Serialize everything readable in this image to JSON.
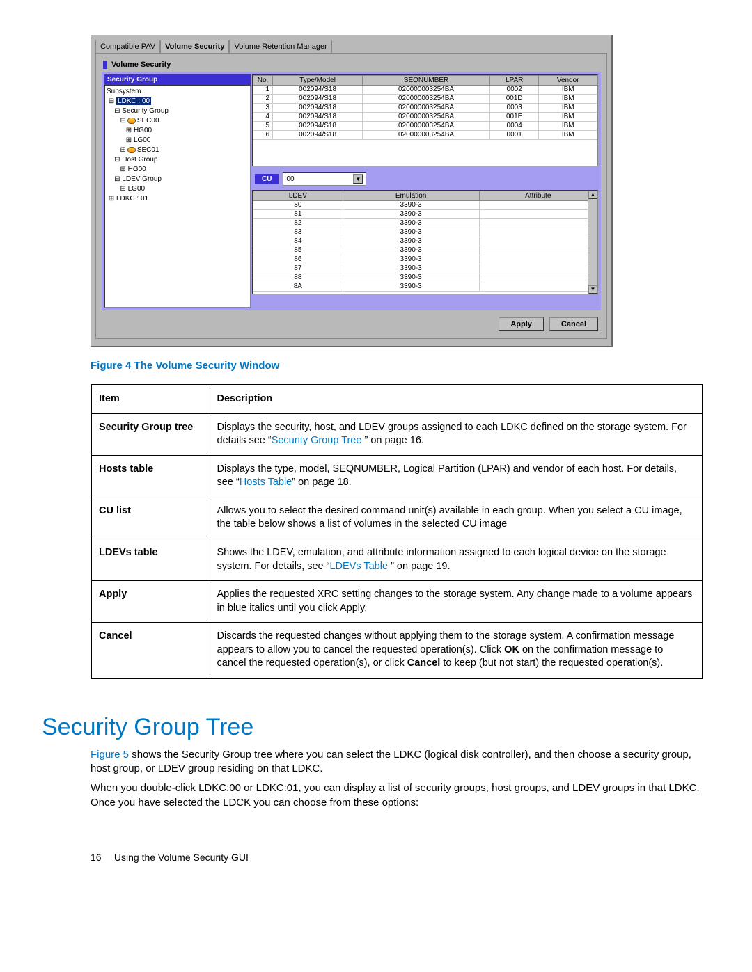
{
  "screenshot": {
    "tabs": [
      "Compatible PAV",
      "Volume Security",
      "Volume Retention Manager"
    ],
    "active_tab": "Volume Security",
    "panel_title": "Volume Security",
    "tree_header": "Security Group",
    "tree": {
      "root": "Subsystem",
      "ldkc00": "LDKC : 00",
      "secgrp": "Security Group",
      "sec00": "SEC00",
      "hg00a": "HG00",
      "lg00a": "LG00",
      "sec01": "SEC01",
      "hostgrp": "Host Group",
      "hg00b": "HG00",
      "ldevgrp": "LDEV Group",
      "lg00b": "LG00",
      "ldkc01": "LDKC : 01"
    },
    "hosts": {
      "headers": [
        "No.",
        "Type/Model",
        "SEQNUMBER",
        "LPAR",
        "Vendor"
      ],
      "rows": [
        [
          "1",
          "002094/S18",
          "020000003254BA",
          "0002",
          "IBM"
        ],
        [
          "2",
          "002094/S18",
          "020000003254BA",
          "001D",
          "IBM"
        ],
        [
          "3",
          "002094/S18",
          "020000003254BA",
          "0003",
          "IBM"
        ],
        [
          "4",
          "002094/S18",
          "020000003254BA",
          "001E",
          "IBM"
        ],
        [
          "5",
          "002094/S18",
          "020000003254BA",
          "0004",
          "IBM"
        ],
        [
          "6",
          "002094/S18",
          "020000003254BA",
          "0001",
          "IBM"
        ]
      ]
    },
    "cu": {
      "label": "CU",
      "value": "00"
    },
    "ldevs": {
      "headers": [
        "LDEV",
        "Emulation",
        "Attribute"
      ],
      "rows": [
        [
          "80",
          "3390-3",
          ""
        ],
        [
          "81",
          "3390-3",
          ""
        ],
        [
          "82",
          "3390-3",
          ""
        ],
        [
          "83",
          "3390-3",
          ""
        ],
        [
          "84",
          "3390-3",
          ""
        ],
        [
          "85",
          "3390-3",
          ""
        ],
        [
          "86",
          "3390-3",
          ""
        ],
        [
          "87",
          "3390-3",
          ""
        ],
        [
          "88",
          "3390-3",
          ""
        ],
        [
          "8A",
          "3390-3",
          ""
        ]
      ]
    },
    "buttons": {
      "apply": "Apply",
      "cancel": "Cancel"
    }
  },
  "caption": "Figure 4 The Volume Security Window",
  "table": {
    "head": [
      "Item",
      "Description"
    ],
    "rows": [
      {
        "item": "Security Group tree",
        "desc_pre": "Displays the security, host, and LDEV groups assigned to each LDKC defined on the storage system. For details see “",
        "link": "Security Group Tree ",
        "desc_post": "” on page 16."
      },
      {
        "item": "Hosts table",
        "desc_pre": "Displays the type, model, SEQNUMBER, Logical Partition (LPAR) and vendor of each host. For details, see “",
        "link": "Hosts Table",
        "desc_post": "” on page 18."
      },
      {
        "item": "CU list",
        "desc": "Allows you to select the desired command unit(s) available in each group. When you select a CU image, the table below shows a list of volumes in the selected CU image"
      },
      {
        "item": "LDEVs table",
        "desc_pre": "Shows the LDEV, emulation, and attribute information assigned to each logical device on the storage system. For details, see “",
        "link": "LDEVs Table ",
        "desc_post": "” on page 19."
      },
      {
        "item": "Apply",
        "desc": "Applies the requested XRC setting changes to the storage system. Any change made to a volume appears in blue italics until you click Apply."
      },
      {
        "item": "Cancel",
        "desc_parts": {
          "p1": "Discards the requested changes without applying them to the storage system. A confirmation message appears to allow you to cancel the requested operation(s). Click ",
          "b1": "OK",
          "p2": " on the confirmation message to cancel the requested operation(s), or click ",
          "b2": "Cancel",
          "p3": " to keep (but not start) the requested operation(s)."
        }
      }
    ]
  },
  "section_heading": "Security Group Tree",
  "para1_a": "Figure 5",
  "para1_b": " shows the Security Group tree where you can select the LDKC (logical disk controller), and then choose a security group, host group, or LDEV group residing on that LDKC.",
  "para2": "When you double-click LDKC:00 or LDKC:01, you can display a list of security groups, host groups, and LDEV groups in that LDKC. Once you have selected the LDCK you can choose from these options:",
  "footer": {
    "page": "16",
    "title": "Using the Volume Security GUI"
  }
}
